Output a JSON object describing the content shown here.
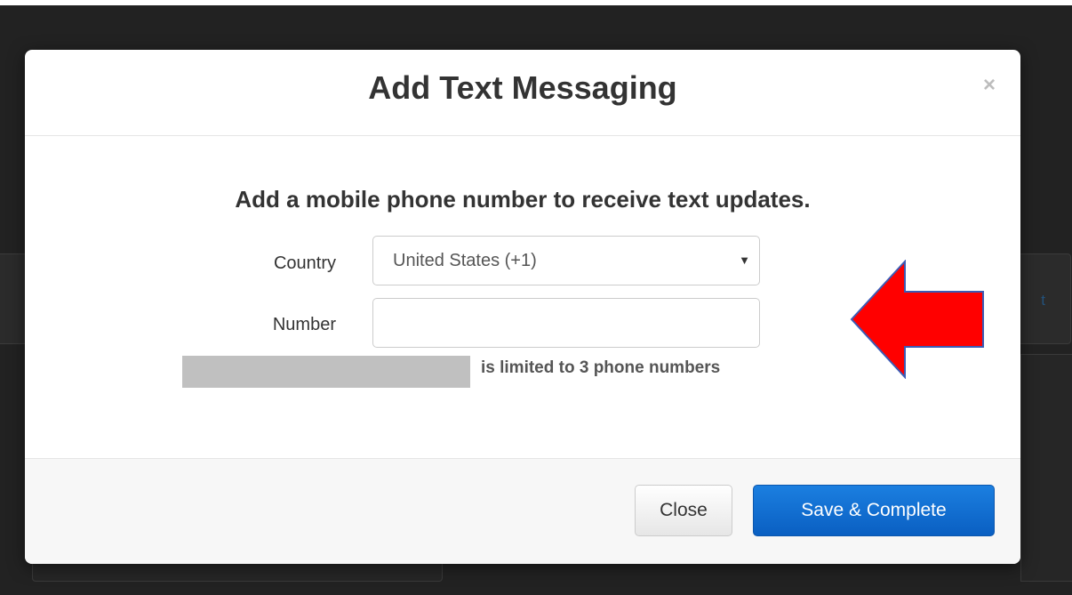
{
  "background": {
    "link_text": "t"
  },
  "modal": {
    "title": "Add Text Messaging",
    "close_icon": "×",
    "body_heading": "Add a mobile phone number to receive text updates.",
    "country_label": "Country",
    "country_value": "United States (+1)",
    "caret": "▼",
    "number_label": "Number",
    "number_value": "",
    "limit_text": "is limited to 3 phone numbers",
    "close_button": "Close",
    "save_button": "Save & Complete"
  },
  "colors": {
    "primary": "#0a5fc2",
    "arrow": "#ff0000"
  }
}
